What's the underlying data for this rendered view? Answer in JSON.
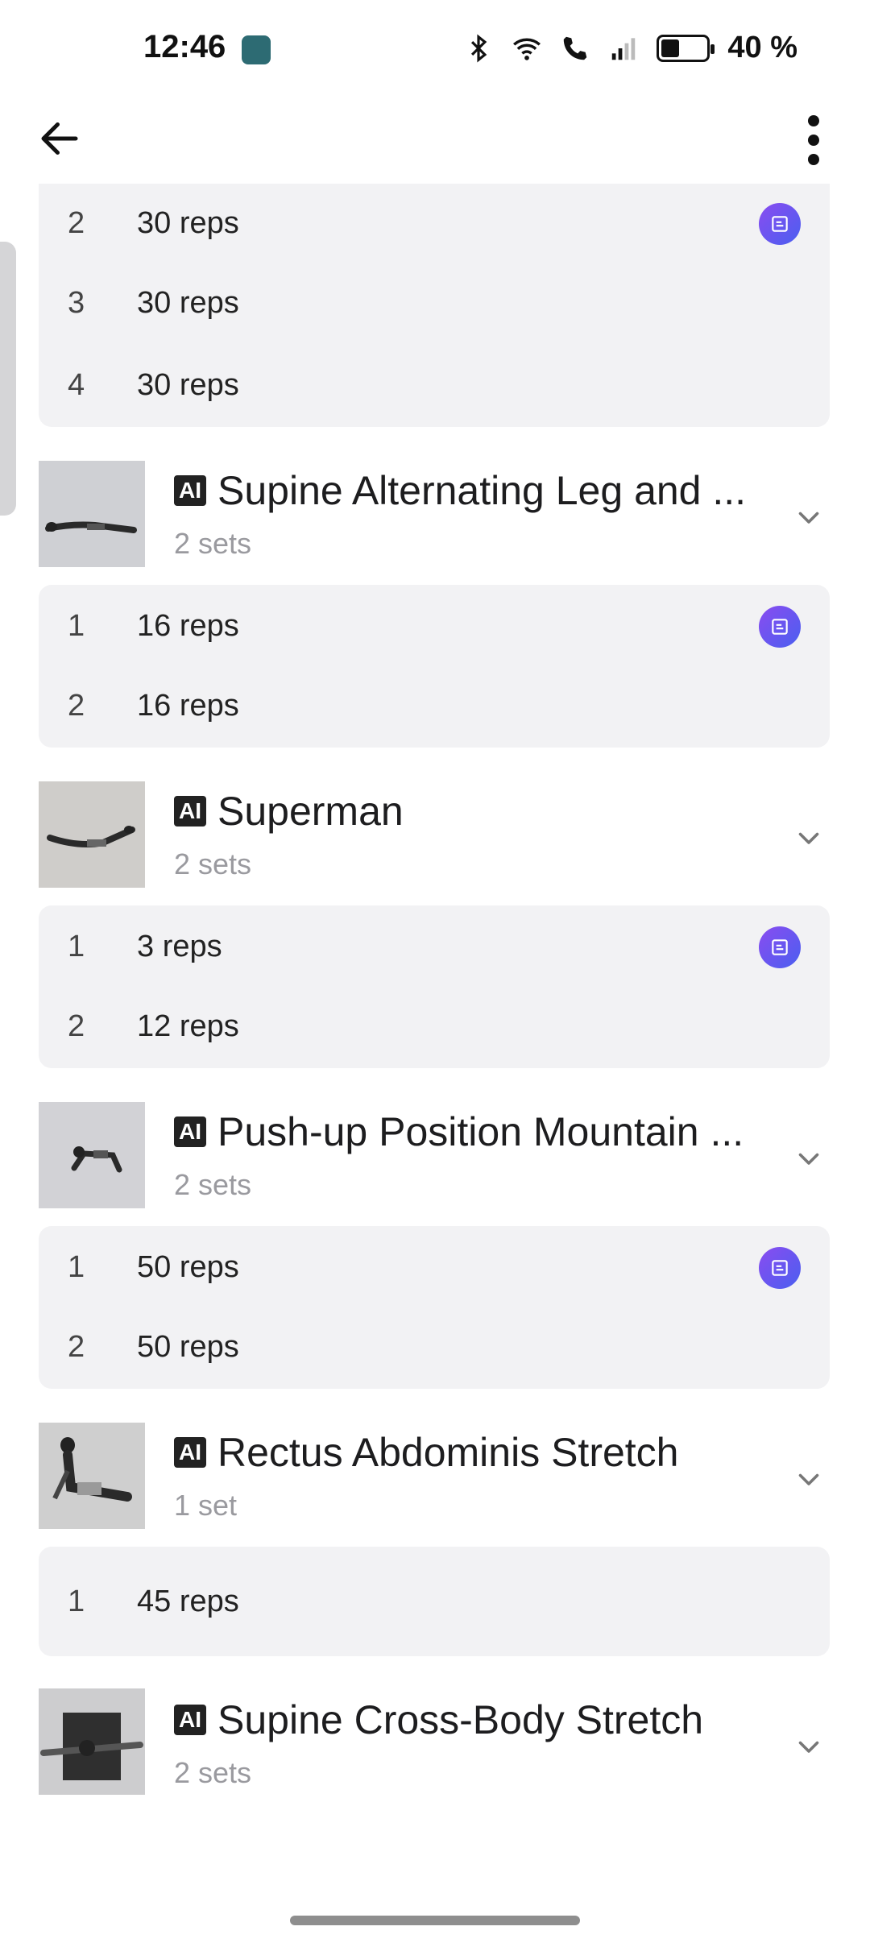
{
  "status_bar": {
    "time": "12:46",
    "app_badge_icon": "photos-app-icon",
    "icons": [
      "bluetooth-icon",
      "wifi-icon",
      "wifi-call-icon",
      "signal-icon"
    ],
    "battery_percent": "40 %",
    "battery_level": 0.4
  },
  "header": {
    "back_icon": "arrow-left-icon",
    "more_icon": "more-vertical-icon"
  },
  "top_sets": [
    {
      "num": "2",
      "reps": "30 reps",
      "ai_note": true
    },
    {
      "num": "3",
      "reps": "30 reps",
      "ai_note": false
    },
    {
      "num": "4",
      "reps": "30 reps",
      "ai_note": false
    }
  ],
  "exercises": [
    {
      "ai_tag": "AI",
      "title": "Supine Alternating Leg and ...",
      "sets_label": "2 sets",
      "sets": [
        {
          "num": "1",
          "reps": "16 reps",
          "ai_note": true
        },
        {
          "num": "2",
          "reps": "16 reps",
          "ai_note": false
        }
      ]
    },
    {
      "ai_tag": "AI",
      "title": "Superman",
      "sets_label": "2 sets",
      "sets": [
        {
          "num": "1",
          "reps": "3 reps",
          "ai_note": true
        },
        {
          "num": "2",
          "reps": "12 reps",
          "ai_note": false
        }
      ]
    },
    {
      "ai_tag": "AI",
      "title": "Push-up Position Mountain ...",
      "sets_label": "2 sets",
      "sets": [
        {
          "num": "1",
          "reps": "50 reps",
          "ai_note": true
        },
        {
          "num": "2",
          "reps": "50 reps",
          "ai_note": false
        }
      ]
    },
    {
      "ai_tag": "AI",
      "title": "Rectus Abdominis Stretch",
      "sets_label": "1 set",
      "sets": [
        {
          "num": "1",
          "reps": "45 reps",
          "ai_note": false
        }
      ]
    },
    {
      "ai_tag": "AI",
      "title": "Supine Cross-Body Stretch",
      "sets_label": "2 sets",
      "sets": []
    }
  ],
  "colors": {
    "accent_gradient_start": "#8a4cf0",
    "accent_gradient_end": "#4a5ff0",
    "card_bg": "#f2f2f4"
  }
}
